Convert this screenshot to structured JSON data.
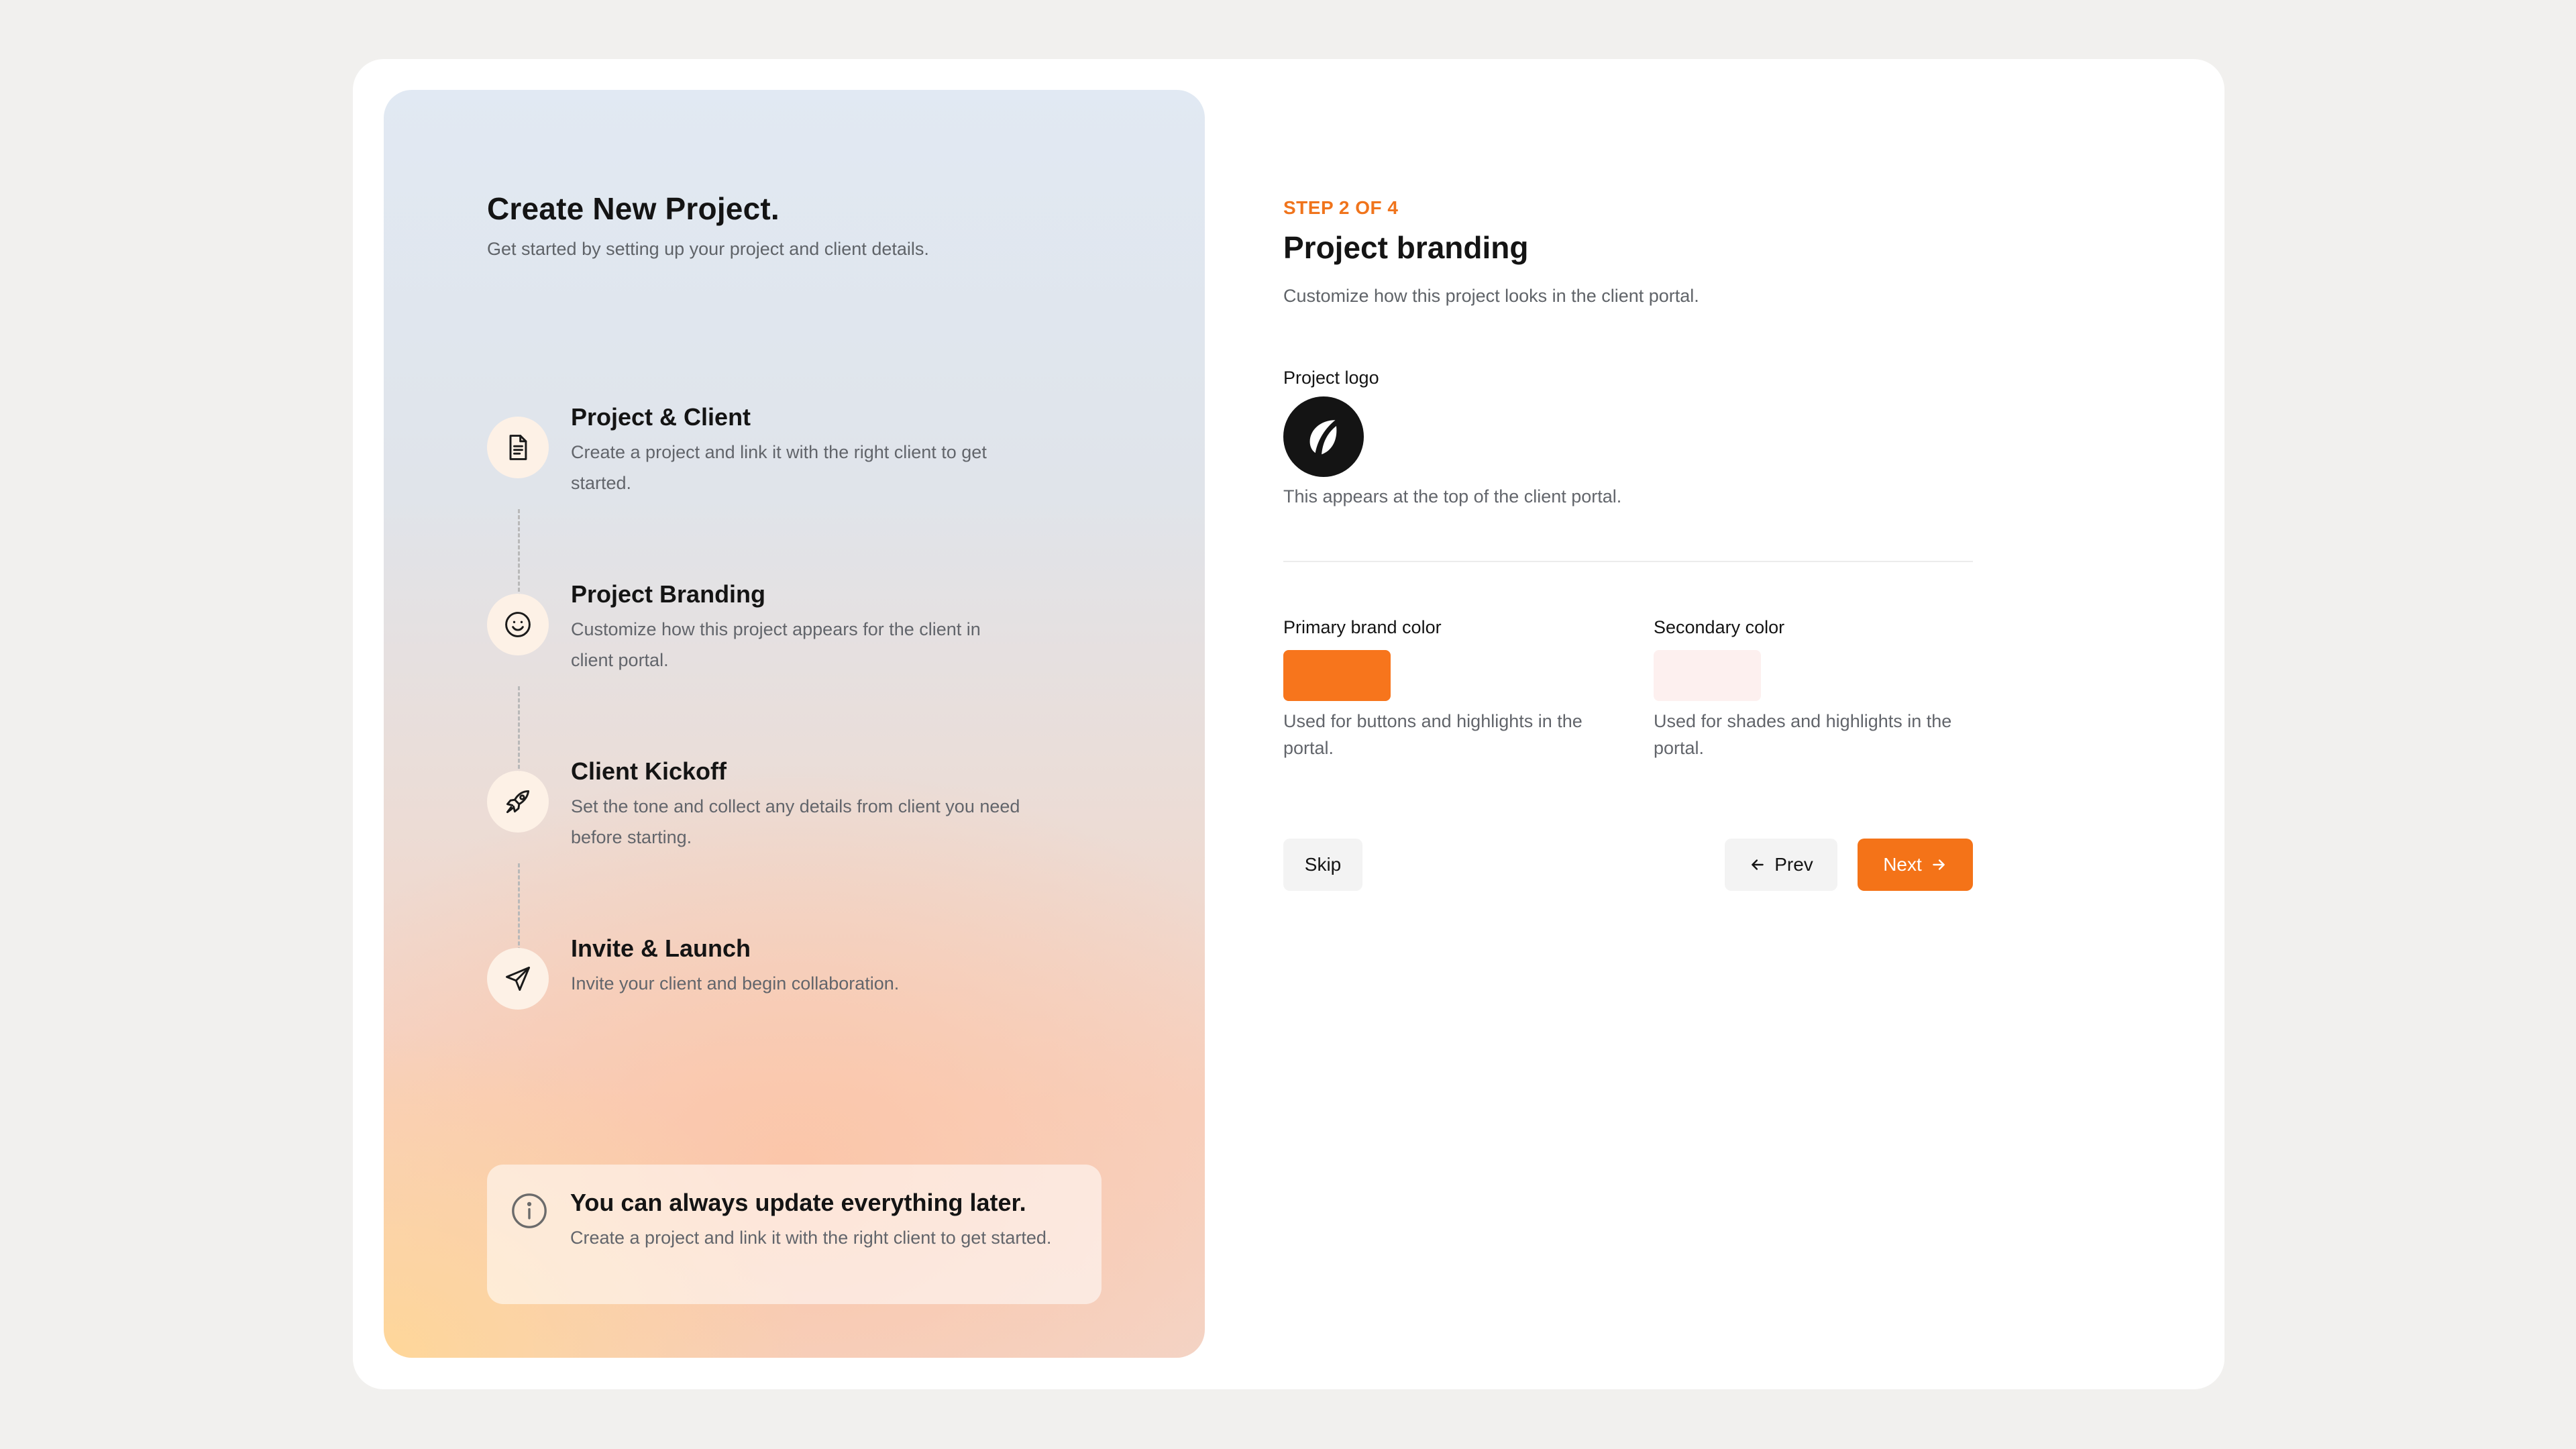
{
  "colors": {
    "accent": "#f47318",
    "primary_swatch": "#f7751c",
    "secondary_swatch": "#fdf0ef"
  },
  "sidebar": {
    "title": "Create New Project.",
    "subtitle": "Get started by setting up your project and client details.",
    "steps": [
      {
        "icon": "document-icon",
        "title": "Project & Client",
        "desc": "Create a project and link it with the right client to get started."
      },
      {
        "icon": "smiley-icon",
        "title": "Project Branding",
        "desc": "Customize how this project appears for the client in client portal."
      },
      {
        "icon": "rocket-icon",
        "title": "Client Kickoff",
        "desc": "Set the tone and collect any details from client you need before starting."
      },
      {
        "icon": "send-icon",
        "title": "Invite & Launch",
        "desc": "Invite your client and begin collaboration."
      }
    ],
    "info": {
      "icon": "info-icon",
      "title": "You can always update everything later.",
      "desc": "Create a project and link it with the right client to get started."
    }
  },
  "main": {
    "step_label": "STEP 2 OF 4",
    "title": "Project branding",
    "subtitle": "Customize how this project looks in the client portal.",
    "logo": {
      "label": "Project logo",
      "hint": "This appears at the top of the client portal."
    },
    "primary_color": {
      "label": "Primary brand color",
      "hint": "Used for buttons and highlights in the portal."
    },
    "secondary_color": {
      "label": "Secondary color",
      "hint": "Used for shades and highlights in the portal."
    }
  },
  "actions": {
    "skip": "Skip",
    "prev": "Prev",
    "next": "Next"
  }
}
